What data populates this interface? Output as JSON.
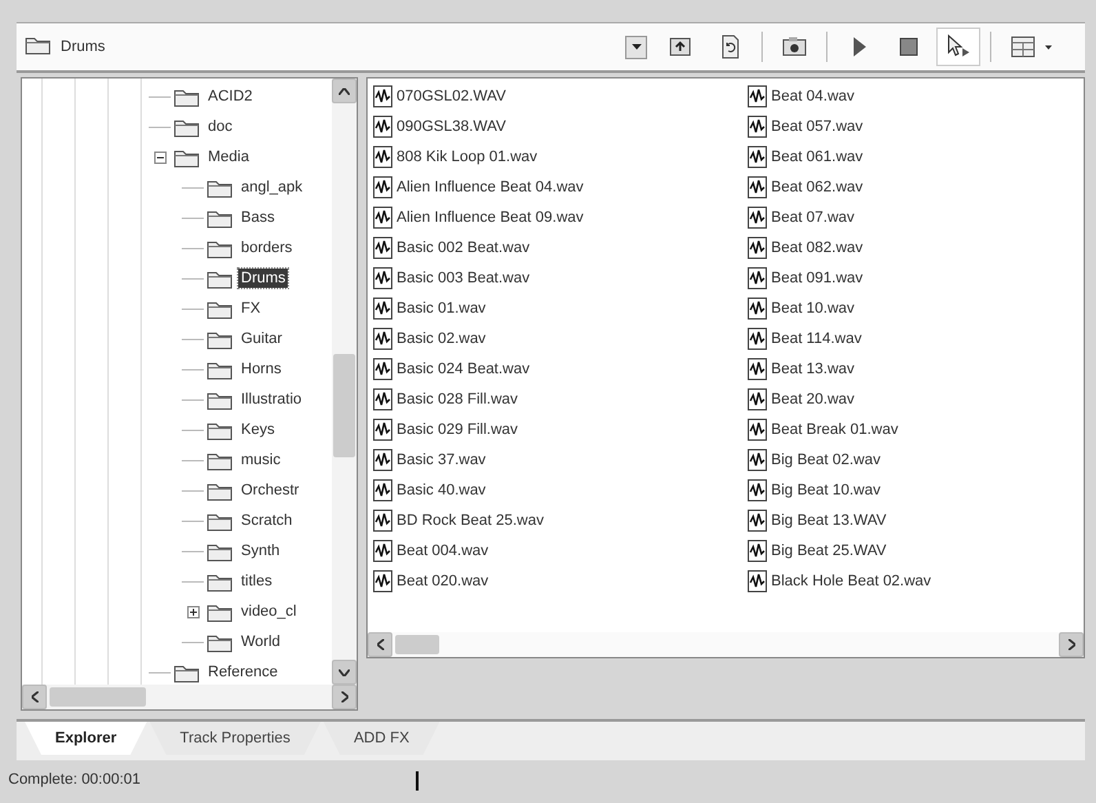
{
  "address": {
    "value": "Drums"
  },
  "toolbar": [
    {
      "kind": "up",
      "on": false
    },
    {
      "kind": "refresh",
      "on": false
    },
    {
      "kind": "capture",
      "on": false
    },
    {
      "kind": "play",
      "on": false
    },
    {
      "kind": "stop",
      "on": false
    },
    {
      "kind": "autopreview",
      "on": true
    },
    {
      "kind": "views",
      "on": false
    }
  ],
  "tree": [
    {
      "label": "ACID2",
      "selected": false
    },
    {
      "label": "doc",
      "selected": false
    },
    {
      "label": "Media",
      "selected": false,
      "expanded": true,
      "children": [
        {
          "label": "angl_apk",
          "selected": false
        },
        {
          "label": "Bass",
          "selected": false
        },
        {
          "label": "borders",
          "selected": false
        },
        {
          "label": "Drums",
          "selected": true
        },
        {
          "label": "FX",
          "selected": false
        },
        {
          "label": "Guitar",
          "selected": false
        },
        {
          "label": "Horns",
          "selected": false
        },
        {
          "label": "Illustratio",
          "selected": false
        },
        {
          "label": "Keys",
          "selected": false
        },
        {
          "label": "music",
          "selected": false
        },
        {
          "label": "Orchestr",
          "selected": false
        },
        {
          "label": "Scratch",
          "selected": false
        },
        {
          "label": "Synth",
          "selected": false
        },
        {
          "label": "titles",
          "selected": false
        },
        {
          "label": "video_cl",
          "selected": false,
          "expanded": false
        },
        {
          "label": "World",
          "selected": false
        }
      ]
    },
    {
      "label": "Reference",
      "selected": false
    }
  ],
  "files": [
    "070GSL02.WAV",
    "090GSL38.WAV",
    "808 Kik Loop 01.wav",
    "Alien Influence Beat 04.wav",
    "Alien Influence Beat 09.wav",
    "Basic 002 Beat.wav",
    "Basic 003 Beat.wav",
    "Basic 01.wav",
    "Basic 02.wav",
    "Basic 024 Beat.wav",
    "Basic 028 Fill.wav",
    "Basic 029 Fill.wav",
    "Basic 37.wav",
    "Basic 40.wav",
    "BD Rock Beat 25.wav",
    "Beat 004.wav",
    "Beat 020.wav",
    "Beat 04.wav",
    "Beat 057.wav",
    "Beat 061.wav",
    "Beat 062.wav",
    "Beat 07.wav",
    "Beat 082.wav",
    "Beat 091.wav",
    "Beat 10.wav",
    "Beat 114.wav",
    "Beat 13.wav",
    "Beat 20.wav",
    "Beat Break 01.wav",
    "Big Beat 02.wav",
    "Big Beat 10.wav",
    "Big Beat 13.WAV",
    "Big Beat 25.WAV",
    "Black Hole Beat 02.wav"
  ],
  "tabs": [
    {
      "label": "Explorer",
      "selected": true
    },
    {
      "label": "Track Properties",
      "selected": false
    },
    {
      "label": "ADD FX",
      "selected": false
    }
  ],
  "status_bar": {
    "text": "Complete: 00:00:01"
  }
}
